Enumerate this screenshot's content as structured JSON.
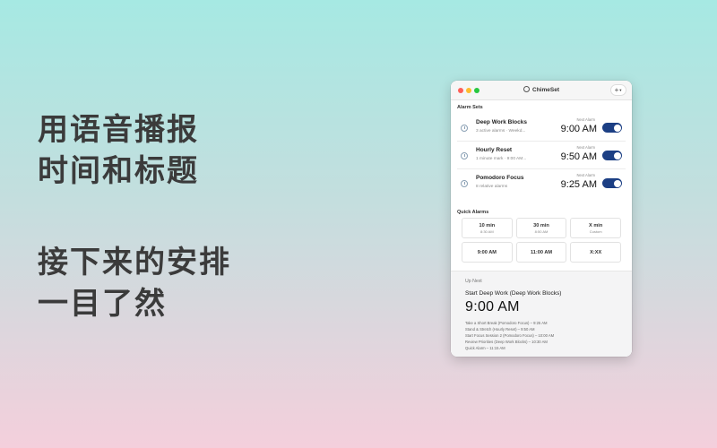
{
  "promo": {
    "headline1": [
      "用语音播报",
      "时间和标题"
    ],
    "headline2": [
      "接下来的安排",
      "一目了然"
    ]
  },
  "window": {
    "title": "ChimeSet",
    "add_button_icon": "plus-icon",
    "alarm_sets_label": "Alarm Sets",
    "alarm_sets": [
      {
        "name": "Deep Work Blocks",
        "desc": "3 active alarms · Weekd...",
        "next_label": "Next Alarm",
        "next_time": "9:00 AM",
        "enabled": true,
        "icon": "clock-icon"
      },
      {
        "name": "Hourly Reset",
        "desc": "1 minute mark · 9:00 AM...",
        "next_label": "Next Alarm",
        "next_time": "9:50 AM",
        "enabled": true,
        "icon": "history-icon"
      },
      {
        "name": "Pomodoro Focus",
        "desc": "8 relative alarms",
        "next_label": "Next Alarm",
        "next_time": "9:25 AM",
        "enabled": true,
        "icon": "timer-icon"
      }
    ],
    "quick_alarms_label": "Quick Alarms",
    "quick_alarms": [
      {
        "main": "10 min",
        "sub": "8:30 AM"
      },
      {
        "main": "30 min",
        "sub": "8:50 AM"
      },
      {
        "main": "X min",
        "sub": "Custom"
      },
      {
        "main": "9:00 AM",
        "sub": ""
      },
      {
        "main": "11:00 AM",
        "sub": ""
      },
      {
        "main": "X:XX",
        "sub": ""
      }
    ],
    "up_next": {
      "label": "Up Next",
      "title": "Start Deep Work (Deep Work Blocks)",
      "time": "9:00 AM",
      "upcoming": [
        "Take a Short Break (Pomodoro Focus) – 9:25 AM",
        "Stand & Stretch (Hourly Reset) – 9:50 AM",
        "Start Focus Session 2 (Pomodoro Focus) – 10:00 AM",
        "Review Priorities (Deep Work Blocks) – 10:30 AM",
        "Quick Alarm – 11:15 AM"
      ]
    }
  },
  "colors": {
    "toggle_on": "#1c3f84",
    "traffic_red": "#fe5f57",
    "traffic_yellow": "#febc2e",
    "traffic_green": "#28c840"
  }
}
